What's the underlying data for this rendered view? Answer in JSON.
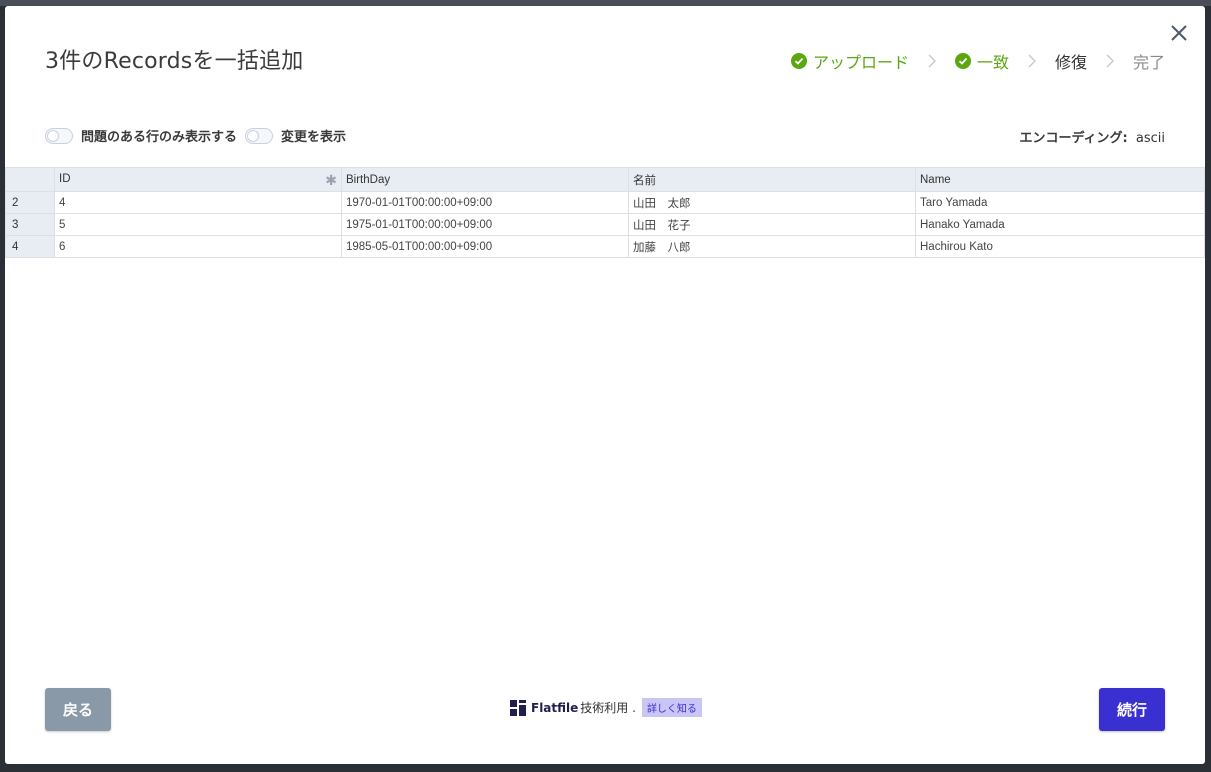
{
  "modal": {
    "title": "3件のRecordsを一括追加"
  },
  "stepper": {
    "steps": [
      {
        "label": "アップロード",
        "state": "done"
      },
      {
        "label": "一致",
        "state": "done"
      },
      {
        "label": "修復",
        "state": "active"
      },
      {
        "label": "完了",
        "state": "todo"
      }
    ]
  },
  "filters": {
    "only_problem_rows": "問題のある行のみ表示する",
    "show_changes": "変更を表示"
  },
  "encoding": {
    "label": "エンコーディング:",
    "value": "ascii"
  },
  "table": {
    "columns": [
      "ID",
      "BirthDay",
      "名前",
      "Name"
    ],
    "rows": [
      {
        "num": "2",
        "cells": [
          "4",
          "1970-01-01T00:00:00+09:00",
          "山田　太郎",
          "Taro Yamada"
        ]
      },
      {
        "num": "3",
        "cells": [
          "5",
          "1975-01-01T00:00:00+09:00",
          "山田　花子",
          "Hanako Yamada"
        ]
      },
      {
        "num": "4",
        "cells": [
          "6",
          "1985-05-01T00:00:00+09:00",
          "加藤　八郎",
          "Hachirou Kato"
        ]
      }
    ]
  },
  "footer": {
    "back_label": "戻る",
    "continue_label": "続行",
    "powered_brand": "Flatfile",
    "powered_text": "技術利用 .",
    "learn_more": "詳しく知る"
  },
  "colors": {
    "success": "#5aa711",
    "primary": "#3a2fd0",
    "back_button": "#8a99a8"
  }
}
